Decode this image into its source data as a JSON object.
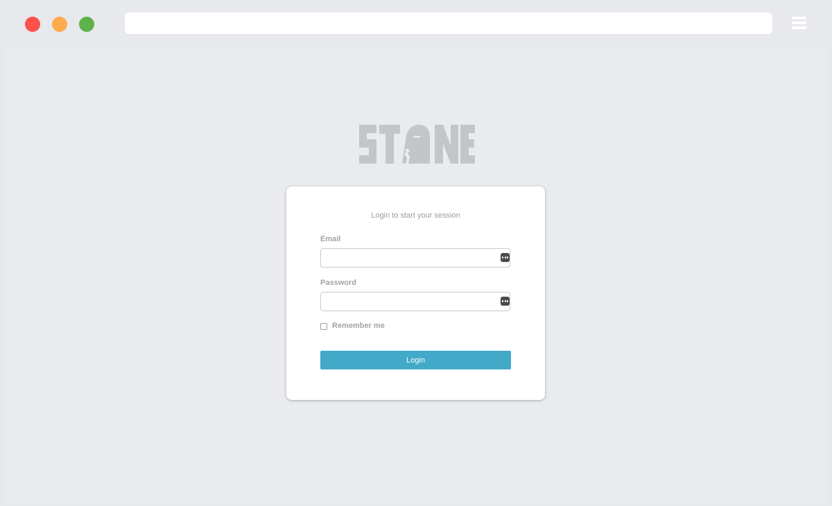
{
  "window": {
    "controls": [
      "close",
      "minimize",
      "maximize"
    ],
    "address_value": "",
    "menu_icon": "hamburger-menu-icon"
  },
  "logo": {
    "text": "STONE",
    "icon": "stone-head-logo"
  },
  "login_card": {
    "subtitle": "Login to start your session",
    "email_label": "Email",
    "email_value": "",
    "password_label": "Password",
    "password_value": "",
    "field_icon": "password-manager-key-icon",
    "remember_label": "Remember me",
    "remember_checked": false,
    "login_button": "Login"
  },
  "colors": {
    "close": "#fc504c",
    "minimize": "#fdab4c",
    "maximize": "#5db349",
    "background": "#e9ebee",
    "logo": "#c3c5c8",
    "login_button": "#42a9c8"
  }
}
